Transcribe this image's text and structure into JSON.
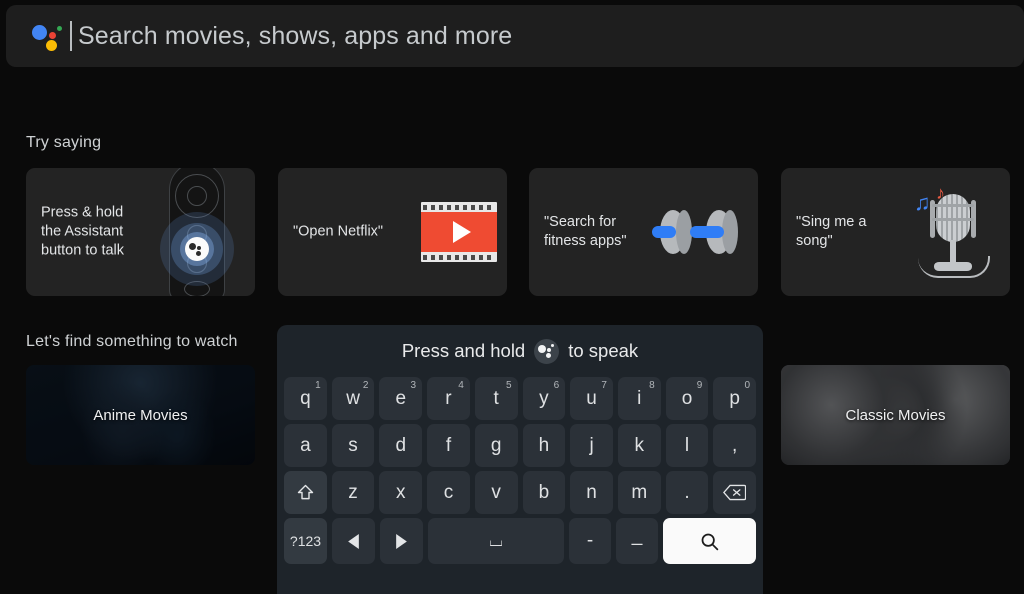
{
  "search": {
    "placeholder": "Search movies, shows, apps and more",
    "assistant_icon": "google-assistant-icon",
    "colors": {
      "blue": "#4285f4",
      "red": "#ea4335",
      "yellow": "#fbbc05",
      "green": "#34a853"
    }
  },
  "sections": {
    "try_saying": "Try saying",
    "watch": "Let's find something to watch"
  },
  "suggestion_cards": [
    {
      "label": "Press & hold\nthe Assistant\nbutton to talk",
      "art": "tv-remote-illustration"
    },
    {
      "label": "\"Open Netflix\"",
      "art": "film-strip-play-icon"
    },
    {
      "label": "\"Search for\nfitness apps\"",
      "art": "dumbbell-illustration"
    },
    {
      "label": "\"Sing me a\nsong\"",
      "art": "microphone-music-notes-illustration"
    }
  ],
  "watch_cards": [
    {
      "label": "Anime Movies"
    },
    {
      "label": "Classic Movies"
    }
  ],
  "keyboard": {
    "header_prefix": "Press and hold",
    "header_suffix": "to speak",
    "header_icon": "assistant-badge-icon",
    "row1": [
      {
        "key": "q",
        "sup": "1"
      },
      {
        "key": "w",
        "sup": "2"
      },
      {
        "key": "e",
        "sup": "3"
      },
      {
        "key": "r",
        "sup": "4"
      },
      {
        "key": "t",
        "sup": "5"
      },
      {
        "key": "y",
        "sup": "6"
      },
      {
        "key": "u",
        "sup": "7"
      },
      {
        "key": "i",
        "sup": "8"
      },
      {
        "key": "o",
        "sup": "9"
      },
      {
        "key": "p",
        "sup": "0"
      }
    ],
    "row2": [
      "a",
      "s",
      "d",
      "f",
      "g",
      "h",
      "j",
      "k",
      "l",
      ","
    ],
    "row3_letters": [
      "z",
      "x",
      "c",
      "v",
      "b",
      "n",
      "m",
      "."
    ],
    "shift_key": "shift-key",
    "backspace_key": "backspace-key",
    "row4": {
      "symbols_label": "?123",
      "left_arrow": "arrow-left-key",
      "right_arrow": "arrow-right-key",
      "space_glyph": "⌴",
      "hyphen": "-",
      "underscore": "_",
      "search_icon": "search-icon"
    }
  }
}
